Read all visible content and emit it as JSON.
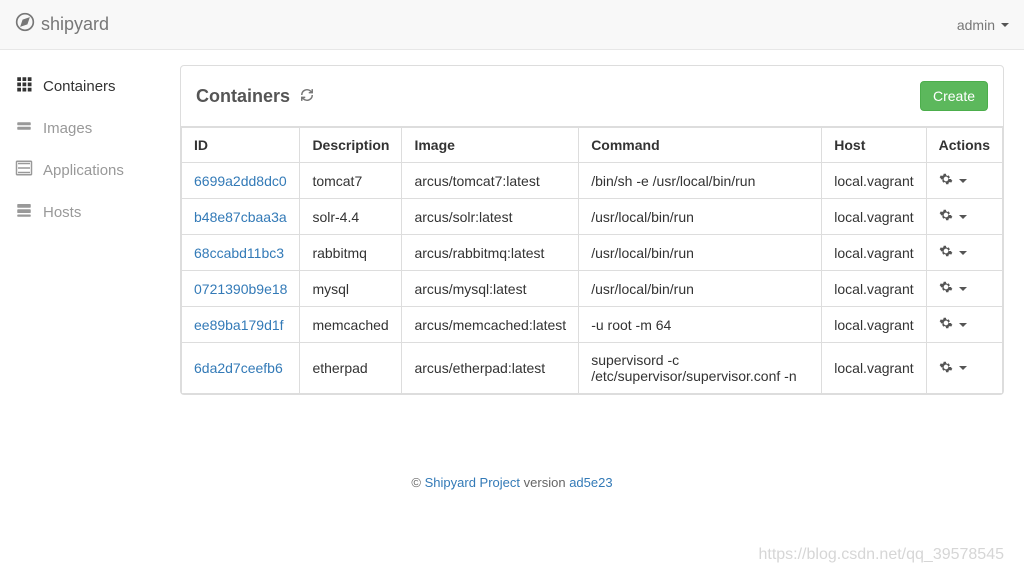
{
  "brand": "shipyard",
  "user": "admin",
  "sidebar": {
    "items": [
      {
        "label": "Containers",
        "active": true
      },
      {
        "label": "Images",
        "active": false
      },
      {
        "label": "Applications",
        "active": false
      },
      {
        "label": "Hosts",
        "active": false
      }
    ]
  },
  "page": {
    "title": "Containers",
    "create_label": "Create"
  },
  "table": {
    "headers": [
      "ID",
      "Description",
      "Image",
      "Command",
      "Host",
      "Actions"
    ],
    "rows": [
      {
        "id": "6699a2dd8dc0",
        "description": "tomcat7",
        "image": "arcus/tomcat7:latest",
        "command": "/bin/sh -e /usr/local/bin/run",
        "host": "local.vagrant"
      },
      {
        "id": "b48e87cbaa3a",
        "description": "solr-4.4",
        "image": "arcus/solr:latest",
        "command": "/usr/local/bin/run",
        "host": "local.vagrant"
      },
      {
        "id": "68ccabd11bc3",
        "description": "rabbitmq",
        "image": "arcus/rabbitmq:latest",
        "command": "/usr/local/bin/run",
        "host": "local.vagrant"
      },
      {
        "id": "0721390b9e18",
        "description": "mysql",
        "image": "arcus/mysql:latest",
        "command": "/usr/local/bin/run",
        "host": "local.vagrant"
      },
      {
        "id": "ee89ba179d1f",
        "description": "memcached",
        "image": "arcus/memcached:latest",
        "command": "-u root -m 64",
        "host": "local.vagrant"
      },
      {
        "id": "6da2d7ceefb6",
        "description": "etherpad",
        "image": "arcus/etherpad:latest",
        "command": "supervisord -c /etc/supervisor/supervisor.conf -n",
        "host": "local.vagrant"
      }
    ]
  },
  "footer": {
    "copyright": "©",
    "project_link": "Shipyard Project",
    "version_text": "version",
    "version": "ad5e23"
  },
  "watermark": "https://blog.csdn.net/qq_39578545"
}
